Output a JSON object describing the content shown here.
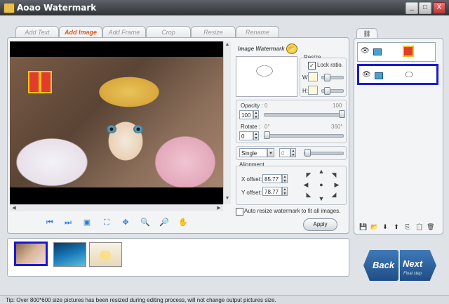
{
  "window": {
    "title": "Aoao Watermark",
    "icon": "app-icon",
    "buttons": [
      "_",
      "□",
      "X"
    ]
  },
  "tabs": [
    {
      "label": "Add Text",
      "active": false
    },
    {
      "label": "Add Image",
      "active": true
    },
    {
      "label": "Add Frame",
      "active": false
    },
    {
      "label": "Crop",
      "active": false
    },
    {
      "label": "Resize",
      "active": false
    },
    {
      "label": "Rename",
      "active": false
    }
  ],
  "image_watermark": {
    "header": "Image Watermark",
    "resize": {
      "label": "Resize",
      "lock_ratio_label": "Lock ratio.",
      "lock_ratio_checked": true,
      "w_label": "W:",
      "h_label": "H:"
    },
    "opacity": {
      "label": "Opacity :",
      "value": "100",
      "min_tick": "0",
      "max_tick": "100",
      "level": 1.0
    },
    "rotate": {
      "label": "Rotate :",
      "value": "0",
      "min_tick": "0°",
      "max_tick": "360°",
      "level": 0.0
    },
    "tile_mode": {
      "value": "Single",
      "count": "0"
    },
    "alignment": {
      "label": "Alignment",
      "x_label": "X offset:",
      "x_value": "85.77",
      "y_label": "Y offset:",
      "y_value": "78.77"
    },
    "auto_resize_label": "Auto resize watermark to fit all images.",
    "auto_resize_checked": false,
    "apply_label": "Apply"
  },
  "nav_buttons": [
    "first-icon",
    "next-icon",
    "fit-icon",
    "full-icon",
    "move-icon",
    "zoom-in-icon",
    "zoom-out-icon",
    "hand-icon"
  ],
  "list_tools": [
    "save-icon",
    "open-icon",
    "down-icon",
    "up-icon",
    "copy-icon",
    "paste-icon",
    "delete-icon"
  ],
  "footer": {
    "back_label": "Back",
    "next_label": "Next",
    "next_sub": "Final step"
  },
  "status": "Tip: Over 800*600 size pictures has been resized during editing process, will not change output pictures size.",
  "colors": {
    "accent_tab": "#e05a1a",
    "selection": "#1a1acc",
    "nav_button": "#2a62a6"
  }
}
